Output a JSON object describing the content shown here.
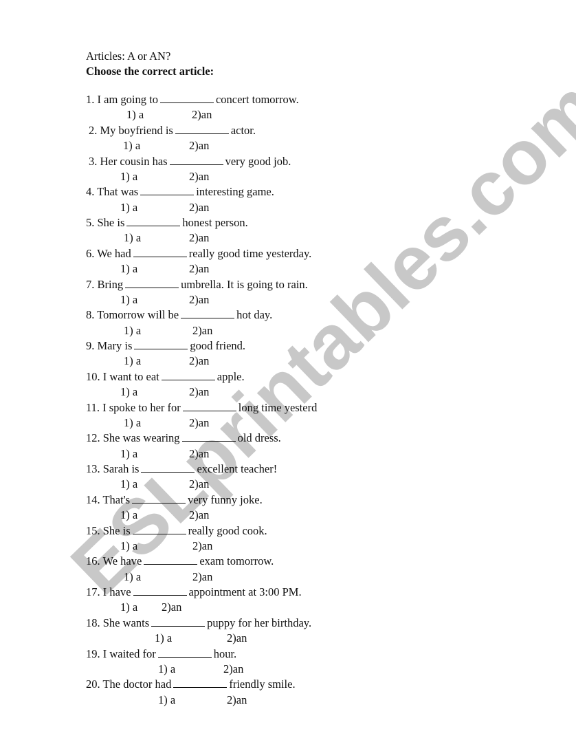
{
  "worksheet": {
    "title": "Articles: A or AN?",
    "instructions": "Choose the correct article:",
    "watermark": "ESLprintables.com",
    "questions": [
      {
        "number": "1.",
        "before": "I am going to",
        "after": "concert tomorrow.",
        "option1": "1) a",
        "option2": "2)an"
      },
      {
        "number": "2.",
        "before": "My boyfriend is",
        "after": "actor.",
        "option1": "1) a",
        "option2": "2)an"
      },
      {
        "number": "3.",
        "before": "Her cousin has",
        "after": "very good job.",
        "option1": "1) a",
        "option2": "2)an"
      },
      {
        "number": "4.",
        "before": "That was",
        "after": "interesting game.",
        "option1": "1) a",
        "option2": "2)an"
      },
      {
        "number": "5.",
        "before": "She is",
        "after": "honest person.",
        "option1": "1) a",
        "option2": "2)an"
      },
      {
        "number": "6.",
        "before": "We had",
        "after": "really good time yesterday.",
        "option1": "1) a",
        "option2": "2)an"
      },
      {
        "number": "7.",
        "before": "Bring",
        "after": "umbrella. It is going to rain.",
        "option1": "1) a",
        "option2": "2)an"
      },
      {
        "number": "8.",
        "before": "Tomorrow will be",
        "after": "hot day.",
        "option1": "1) a",
        "option2": "2)an"
      },
      {
        "number": "9.",
        "before": "Mary is",
        "after": "good friend.",
        "option1": "1) a",
        "option2": "2)an"
      },
      {
        "number": "10.",
        "before": "I want to eat",
        "after": "apple.",
        "option1": "1) a",
        "option2": "2)an"
      },
      {
        "number": "11.",
        "before": "I spoke to her for",
        "after": "long time yesterd",
        "option1": "1) a",
        "option2": "2)an"
      },
      {
        "number": "12.",
        "before": "She was wearing",
        "after": "old dress.",
        "option1": "1) a",
        "option2": "2)an"
      },
      {
        "number": "13.",
        "before": "Sarah is",
        "after": "excellent teacher!",
        "option1": "1) a",
        "option2": "2)an"
      },
      {
        "number": "14.",
        "before": "That's",
        "after": "very funny joke.",
        "option1": "1) a",
        "option2": "2)an"
      },
      {
        "number": "15.",
        "before": "She is",
        "after": "really good cook.",
        "option1": "1) a",
        "option2": "2)an"
      },
      {
        "number": "16.",
        "before": "We have",
        "after": "exam tomorrow.",
        "option1": "1) a",
        "option2": "2)an"
      },
      {
        "number": "17.",
        "before": "I have",
        "after": "appointment at 3:00 PM.",
        "option1": "1) a",
        "option2": "2)an"
      },
      {
        "number": "18.",
        "before": "She wants",
        "after": "puppy for her birthday.",
        "option1": "1) a",
        "option2": "2)an"
      },
      {
        "number": "19.",
        "before": "I waited for",
        "after": "hour.",
        "option1": "1) a",
        "option2": "2)an"
      },
      {
        "number": "20.",
        "before": "The doctor had",
        "after": "friendly smile.",
        "option1": "1) a",
        "option2": "2)an"
      }
    ]
  }
}
